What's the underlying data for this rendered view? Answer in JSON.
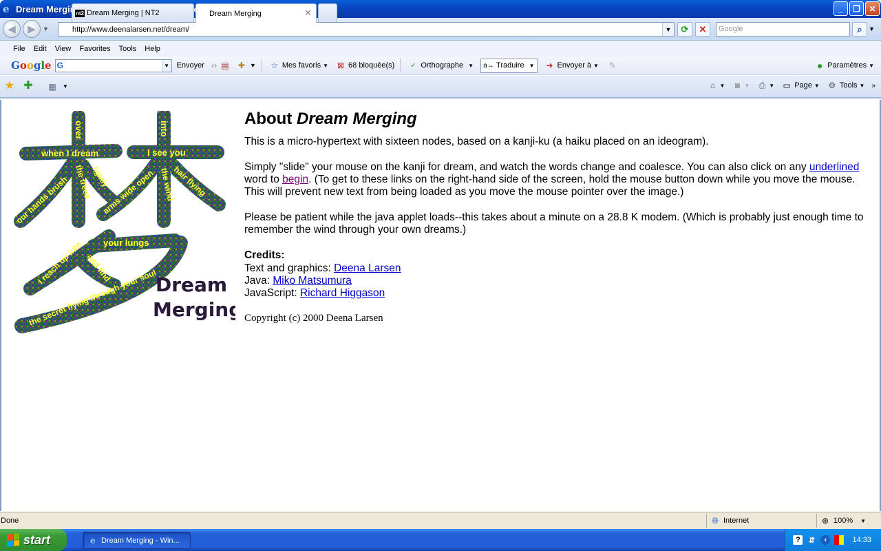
{
  "window": {
    "title": "Dream Merging - Windows Internet Explorer"
  },
  "address": {
    "url": "http://www.deenalarsen.net/dream/"
  },
  "search": {
    "placeholder": "Google"
  },
  "menu": [
    "File",
    "Edit",
    "View",
    "Favorites",
    "Tools",
    "Help"
  ],
  "google_toolbar": {
    "search_text": "G",
    "send": "Envoyer",
    "bookmarks": "Mes favoris",
    "blocked": "68 bloquée(s)",
    "spellcheck": "Orthographe",
    "translate": "Traduire",
    "send_to": "Envoyer à",
    "settings": "Paramètres"
  },
  "tabs": [
    {
      "label": "Dream Merging | NT2",
      "favicon": "nt2"
    },
    {
      "label": "Dream Merging"
    }
  ],
  "command_bar": {
    "page": "Page",
    "tools": "Tools"
  },
  "kanji": {
    "phrases": [
      "over",
      "into",
      "when I dream",
      "I see you",
      "our hands brush",
      "the trees",
      "lightly",
      "arms wide open",
      "the wind",
      "hair flying",
      "your lungs",
      "I reach up into",
      "and find",
      "the secret flying through your soul"
    ],
    "title_line1": "Dream",
    "title_line2": "Merging"
  },
  "article": {
    "heading_prefix": "About ",
    "heading_em": "Dream Merging",
    "p1": "This is a micro-hypertext with sixteen nodes, based on a kanji-ku (a haiku placed on an ideogram).",
    "p2_a": "Simply \"slide\" your mouse on the kanji for dream, and watch the words change and coalesce. You can also click on any ",
    "p2_link1": "underlined",
    "p2_b": " word to ",
    "p2_link2": "begin",
    "p2_c": ". (To get to these links on the right-hand side of the screen, hold the mouse button down while you move the mouse. This will prevent new text from being loaded as you move the mouse pointer over the image.)",
    "p3": "Please be patient while the java applet loads--this takes about a minute on a 28.8 K modem. (Which is probably just enough time to remember the wind through your own dreams.)",
    "credits_heading": "Credits:",
    "credits": [
      {
        "role": "Text and graphics: ",
        "name": "Deena Larsen"
      },
      {
        "role": "Java: ",
        "name": "Miko Matsumura"
      },
      {
        "role": "JavaScript: ",
        "name": "Richard Higgason"
      }
    ],
    "copyright": "Copyright (c) 2000 Deena Larsen"
  },
  "status": {
    "text": "Done",
    "zone": "Internet",
    "zoom": "100%"
  },
  "taskbar": {
    "start": "start",
    "window_btn": "Dream Merging - Win...",
    "clock": "14:33"
  },
  "colors": {
    "link": "#0000cc",
    "visited": "#800080",
    "titlebar": "#0845c0",
    "kanji_yellow": "#ffff33",
    "kanji_green": "#2f6b3a",
    "kanji_purple": "#6a2a8a"
  }
}
